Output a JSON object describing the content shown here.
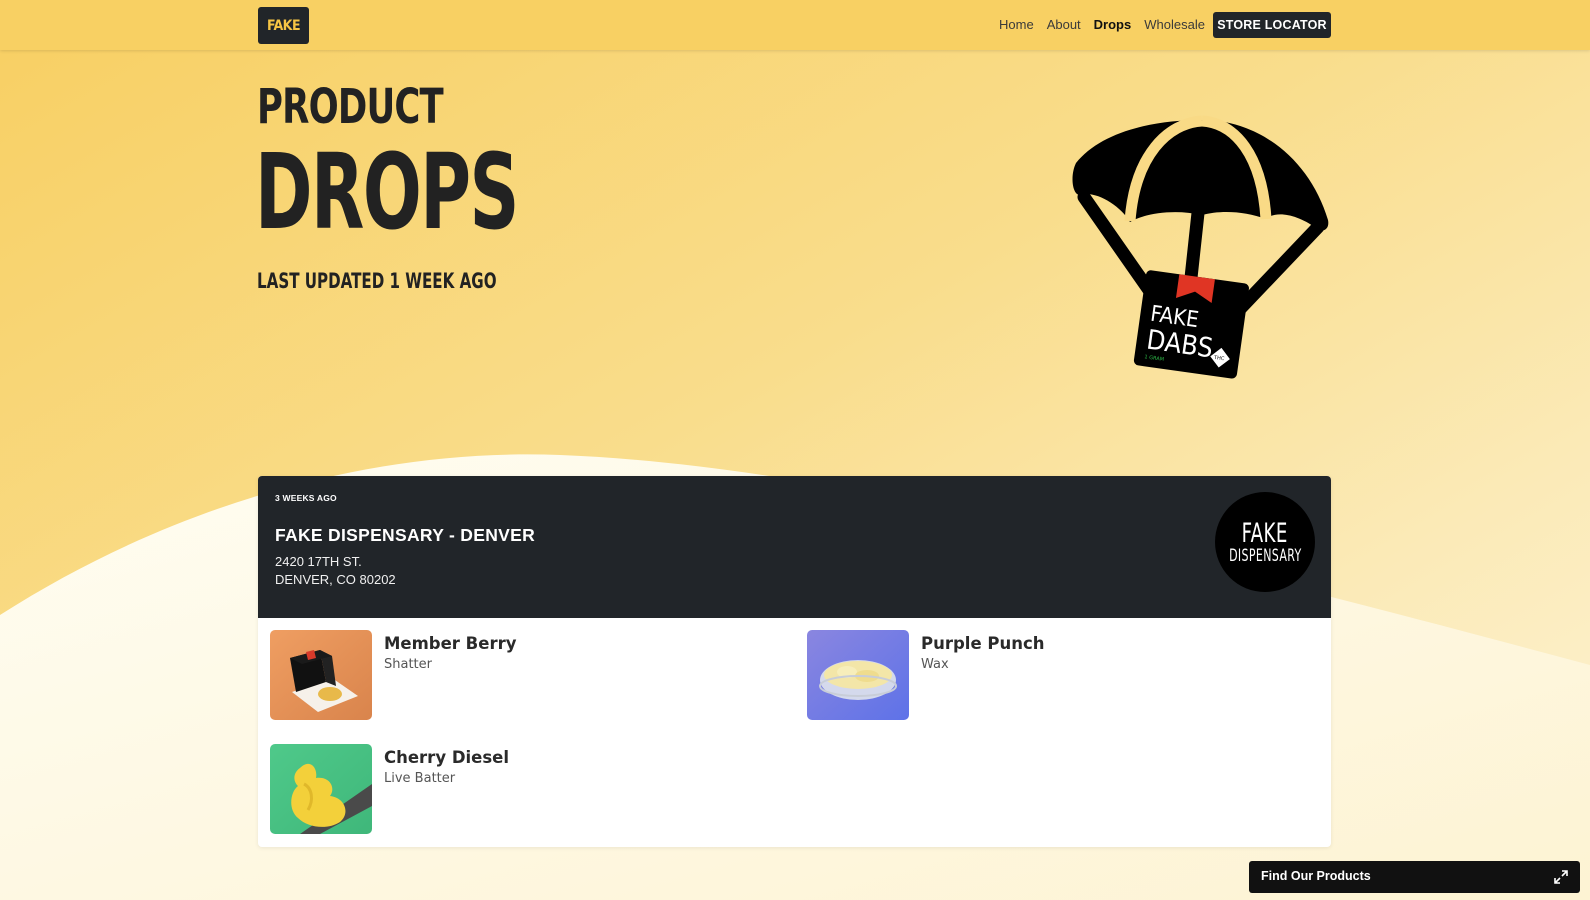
{
  "nav": {
    "brand": "FAKE",
    "links": [
      {
        "label": "Home"
      },
      {
        "label": "About"
      },
      {
        "label": "Drops"
      },
      {
        "label": "Wholesale"
      }
    ],
    "cta": "STORE LOCATOR"
  },
  "hero": {
    "line1": "PRODUCT",
    "line2": "DROPS",
    "updated": "LAST UPDATED 1 WEEK AGO",
    "illustration": {
      "pack_line1": "FAKE",
      "pack_line2": "DABS",
      "pack_badge": "THC",
      "pack_weight": "1 GRAM"
    }
  },
  "drop": {
    "date": "3 WEEKS AGO",
    "dispensary": "FAKE DISPENSARY - DENVER",
    "address_line1": "2420 17TH ST.",
    "address_line2": "DENVER, CO 80202",
    "logo_line1": "FAKE",
    "logo_line2": "DISPENSARY",
    "products": [
      {
        "name": "Member Berry",
        "type": "Shatter"
      },
      {
        "name": "Purple Punch",
        "type": "Wax"
      },
      {
        "name": "Cherry Diesel",
        "type": "Live Batter"
      }
    ]
  },
  "widget": {
    "label": "Find Our Products",
    "icon": "expand-icon"
  },
  "colors": {
    "accent": "#f8d063",
    "dark": "#212529"
  }
}
